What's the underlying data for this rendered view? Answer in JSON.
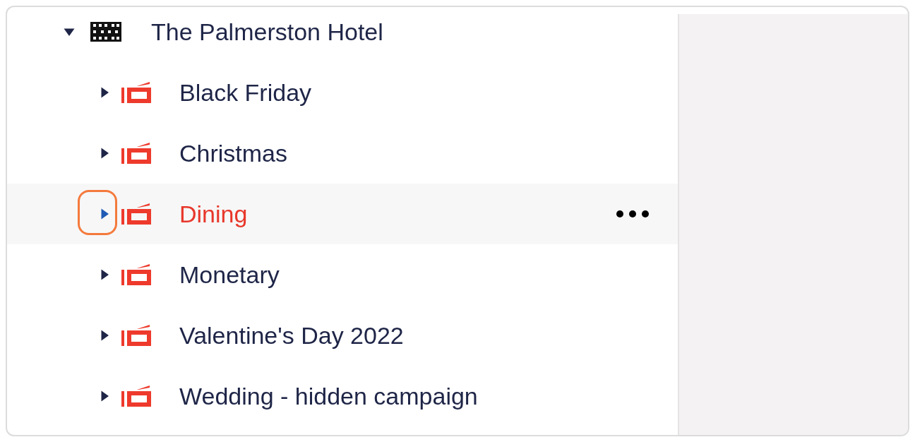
{
  "tree": {
    "label": "The Palmerston Hotel",
    "expanded": true,
    "children": [
      {
        "label": "Black Friday",
        "expanded": false,
        "selected": false,
        "highlighted": false
      },
      {
        "label": "Christmas",
        "expanded": false,
        "selected": false,
        "highlighted": false
      },
      {
        "label": "Dining",
        "expanded": false,
        "selected": true,
        "highlighted": true
      },
      {
        "label": "Monetary",
        "expanded": false,
        "selected": false,
        "highlighted": false
      },
      {
        "label": "Valentine's Day 2022",
        "expanded": false,
        "selected": false,
        "highlighted": false
      },
      {
        "label": "Wedding - hidden campaign",
        "expanded": false,
        "selected": false,
        "highlighted": false
      }
    ]
  }
}
